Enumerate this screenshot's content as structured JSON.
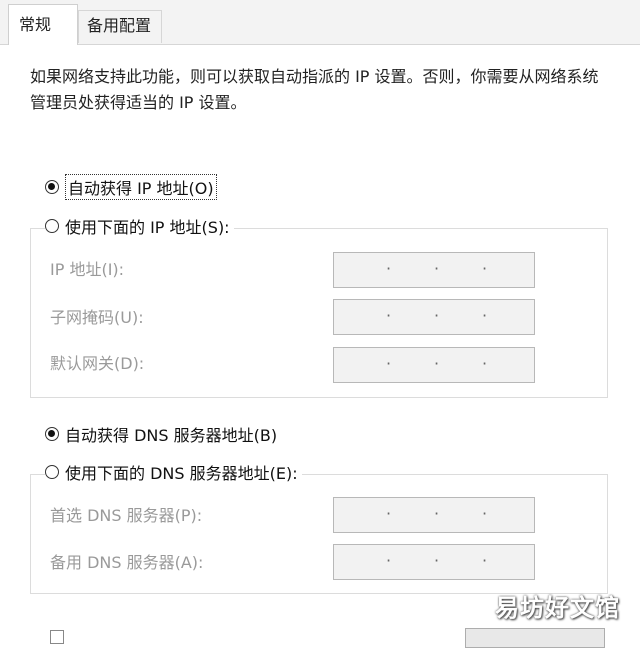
{
  "tabs": [
    {
      "label": "常规",
      "active": true
    },
    {
      "label": "备用配置",
      "active": false
    }
  ],
  "description": "如果网络支持此功能，则可以获取自动指派的 IP 设置。否则，你需要从网络系统管理员处获得适当的 IP 设置。",
  "ip": {
    "auto_label": "自动获得 IP 地址(O)",
    "auto_selected": true,
    "manual_label": "使用下面的 IP 地址(S):",
    "manual_selected": false,
    "fields": [
      {
        "label": "IP 地址(I):",
        "value": ". . ."
      },
      {
        "label": "子网掩码(U):",
        "value": ". . ."
      },
      {
        "label": "默认网关(D):",
        "value": ". . ."
      }
    ]
  },
  "dns": {
    "auto_label": "自动获得 DNS 服务器地址(B)",
    "auto_selected": true,
    "manual_label": "使用下面的 DNS 服务器地址(E):",
    "manual_selected": false,
    "fields": [
      {
        "label": "首选 DNS 服务器(P):",
        "value": ". . ."
      },
      {
        "label": "备用 DNS 服务器(A):",
        "value": ". . ."
      }
    ]
  },
  "watermark": "易坊好文馆",
  "colors": {
    "disabled_text": "#9a9a9a",
    "field_bg": "#f2f2f2",
    "tab_strip": "#f3f3f3"
  }
}
